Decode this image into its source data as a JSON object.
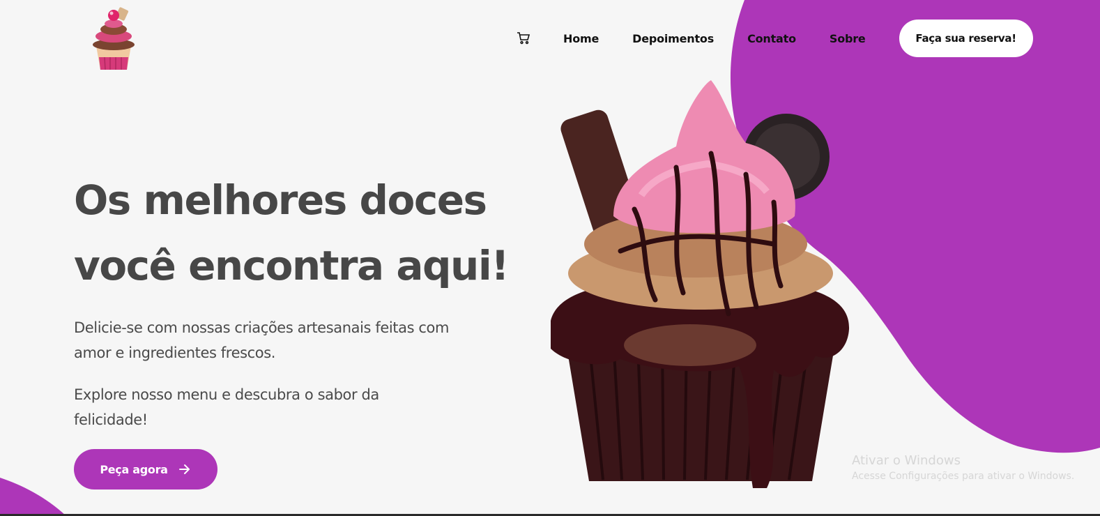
{
  "brand": {
    "logo_icon": "cupcake-logo-icon"
  },
  "nav": {
    "cart_icon": "cart-icon",
    "links": [
      "Home",
      "Depoimentos",
      "Contato",
      "Sobre"
    ],
    "cta_label": "Faça sua reserva!"
  },
  "hero": {
    "title_line1": "Os melhores doces",
    "title_line2": "você encontra aqui!",
    "paragraph1": "Delicie-se com nossas criações artesanais feitas com amor e ingredientes frescos.",
    "paragraph2": "Explore nosso menu e descubra o sabor da felicidade!",
    "button_label": "Peça agora",
    "button_icon": "arrow-right-icon",
    "image_icon": "cupcake-image"
  },
  "watermark": {
    "title": "Ativar o Windows",
    "subtitle": "Acesse Configurações para ativar o Windows."
  },
  "colors": {
    "accent": "#ad36b8",
    "background": "#f6f6f6",
    "heading": "#474747",
    "text": "#4a4a4a"
  }
}
